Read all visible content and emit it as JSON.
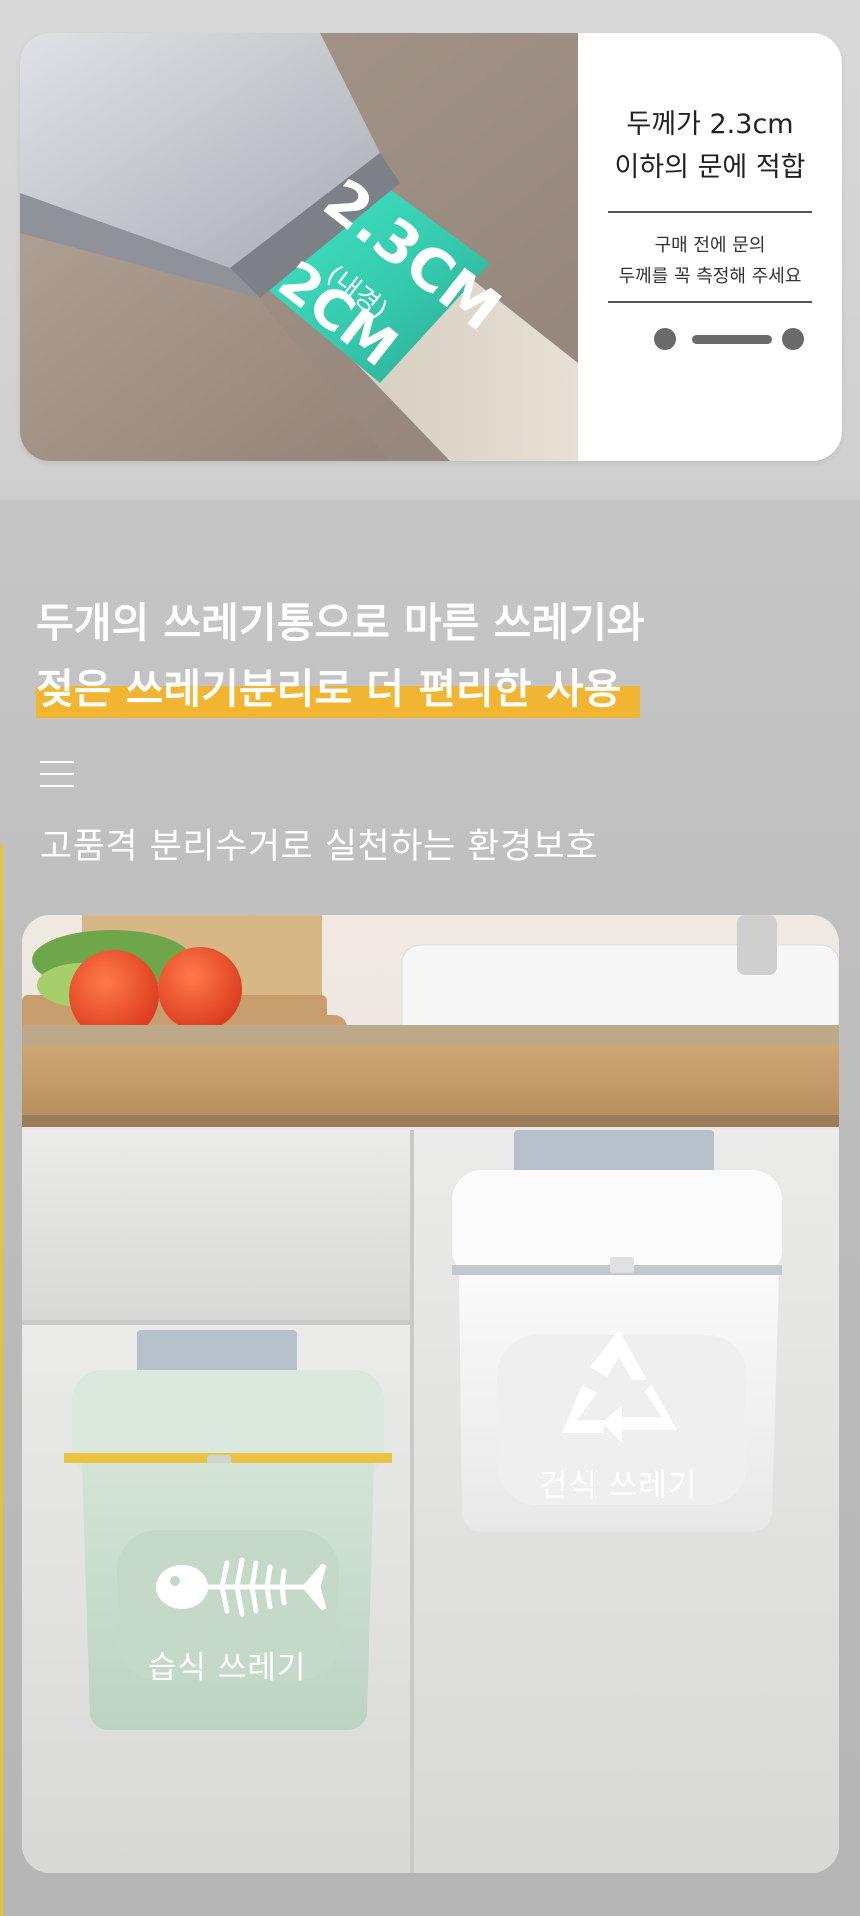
{
  "top_panel": {
    "title": "두께가 2.3cm\n이하의 문에 적합",
    "note": "구매 전에 문의\n두께를 꼭 측정해 주세요",
    "graphic_texts": {
      "outer": "2.3CM",
      "inner_label": "(내경)",
      "inner": "2CM"
    }
  },
  "headline": {
    "line1": "두개의 쓰레기통으로 마른 쓰레기와",
    "line2": "젖은 쓰레기분리로 더 편리한 사용"
  },
  "subheadline": "고품격 분리수거로 실천하는 환경보호",
  "product_photo": {
    "wet_bin_label": "습식 쓰레기",
    "dry_bin_label": "건식 쓰레기"
  },
  "colors": {
    "accent": "#f2b531",
    "mint": "#3fe0c0",
    "wet_bin": "#cfe0d3",
    "dry_bin": "#f6f6f6"
  },
  "icons": [
    "menu-icon",
    "fish-bone-icon",
    "recycle-icon"
  ]
}
